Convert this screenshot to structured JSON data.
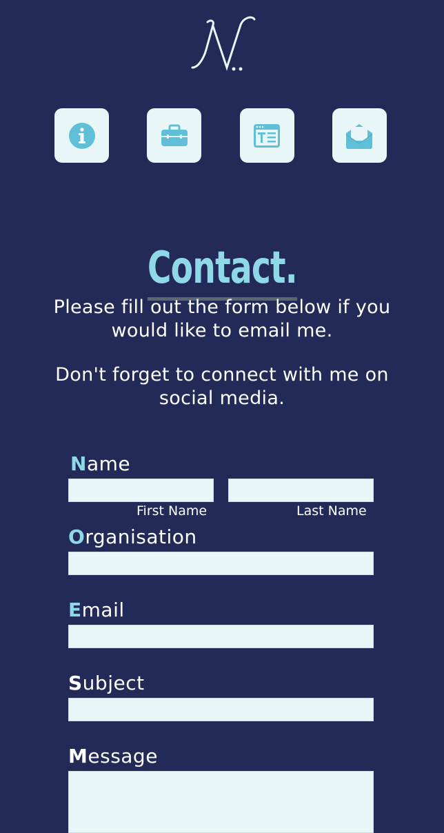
{
  "logo": {
    "text": "N",
    "dots": ".."
  },
  "nav": {
    "items": [
      {
        "icon": "info-icon",
        "label": "About"
      },
      {
        "icon": "briefcase-icon",
        "label": "Portfolio"
      },
      {
        "icon": "article-icon",
        "label": "Blog"
      },
      {
        "icon": "envelope-open-icon",
        "label": "Contact"
      }
    ]
  },
  "page": {
    "title": "Contact.",
    "intro_1": "Please fill out the form below if you would like to email me.",
    "intro_2": "Don't forget to connect with me on social media."
  },
  "form": {
    "name": {
      "label_first": "N",
      "label_rest": "ame",
      "first_value": "",
      "last_value": "",
      "first_sublabel": "First Name",
      "last_sublabel": "Last Name"
    },
    "organisation": {
      "label_first": "O",
      "label_rest": "rganisation",
      "value": ""
    },
    "email": {
      "label_first": "E",
      "label_rest": "mail",
      "value": ""
    },
    "subject": {
      "label_first": "S",
      "label_rest": "ubject",
      "value": ""
    },
    "message": {
      "label_first": "M",
      "label_rest": "essage",
      "value": ""
    }
  },
  "colors": {
    "background": "#232a57",
    "accent": "#8fd8e8",
    "icon": "#5fbfd6",
    "input_bg": "#e8f6f8"
  }
}
